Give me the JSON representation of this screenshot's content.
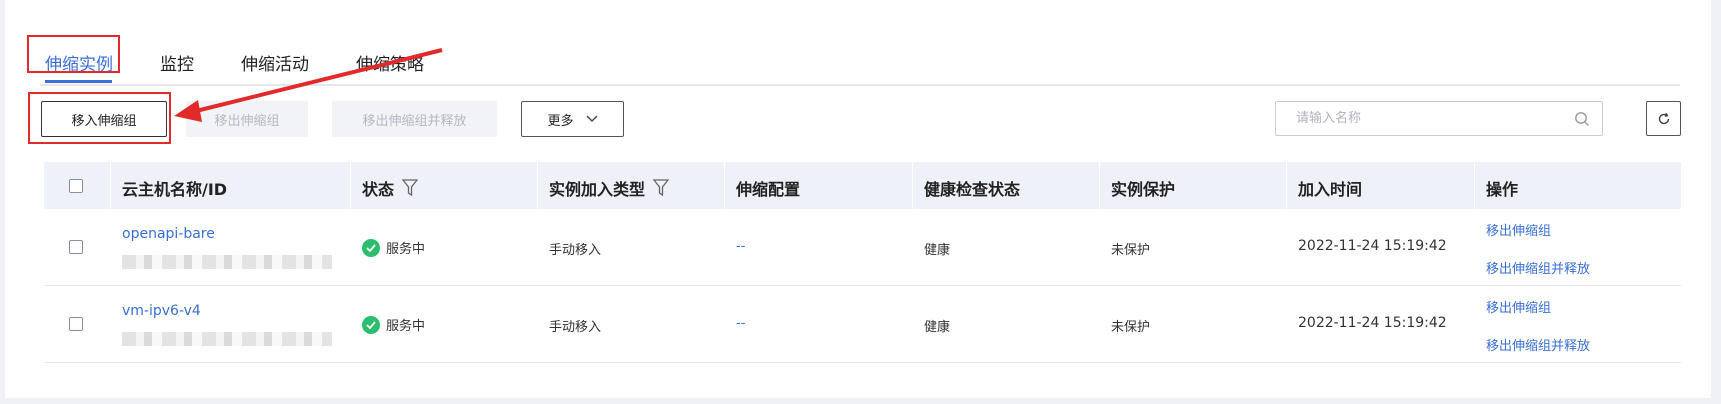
{
  "tabs": [
    {
      "label": "伸缩实例",
      "active": true
    },
    {
      "label": "监控"
    },
    {
      "label": "伸缩活动"
    },
    {
      "label": "伸缩策略"
    }
  ],
  "toolbar": {
    "move_in": "移入伸缩组",
    "move_out": "移出伸缩组",
    "move_out_release": "移出伸缩组并释放",
    "more": "更多"
  },
  "search": {
    "placeholder": "请输入名称"
  },
  "table": {
    "columns": [
      "云主机名称/ID",
      "状态",
      "实例加入类型",
      "伸缩配置",
      "健康检查状态",
      "实例保护",
      "加入时间",
      "操作"
    ],
    "rows": [
      {
        "name": "openapi-bare",
        "status": "服务中",
        "join_type": "手动移入",
        "scaling_config": "--",
        "health": "健康",
        "protection": "未保护",
        "join_time": "2022-11-24 15:19:42",
        "actions": [
          "移出伸缩组",
          "移出伸缩组并释放"
        ]
      },
      {
        "name": "vm-ipv6-v4",
        "status": "服务中",
        "join_type": "手动移入",
        "scaling_config": "--",
        "health": "健康",
        "protection": "未保护",
        "join_time": "2022-11-24 15:19:42",
        "actions": [
          "移出伸缩组",
          "移出伸缩组并释放"
        ]
      }
    ]
  },
  "colors": {
    "accent": "#3a6fd8",
    "annotation": "#e22a2a",
    "success": "#2dbd6e"
  }
}
